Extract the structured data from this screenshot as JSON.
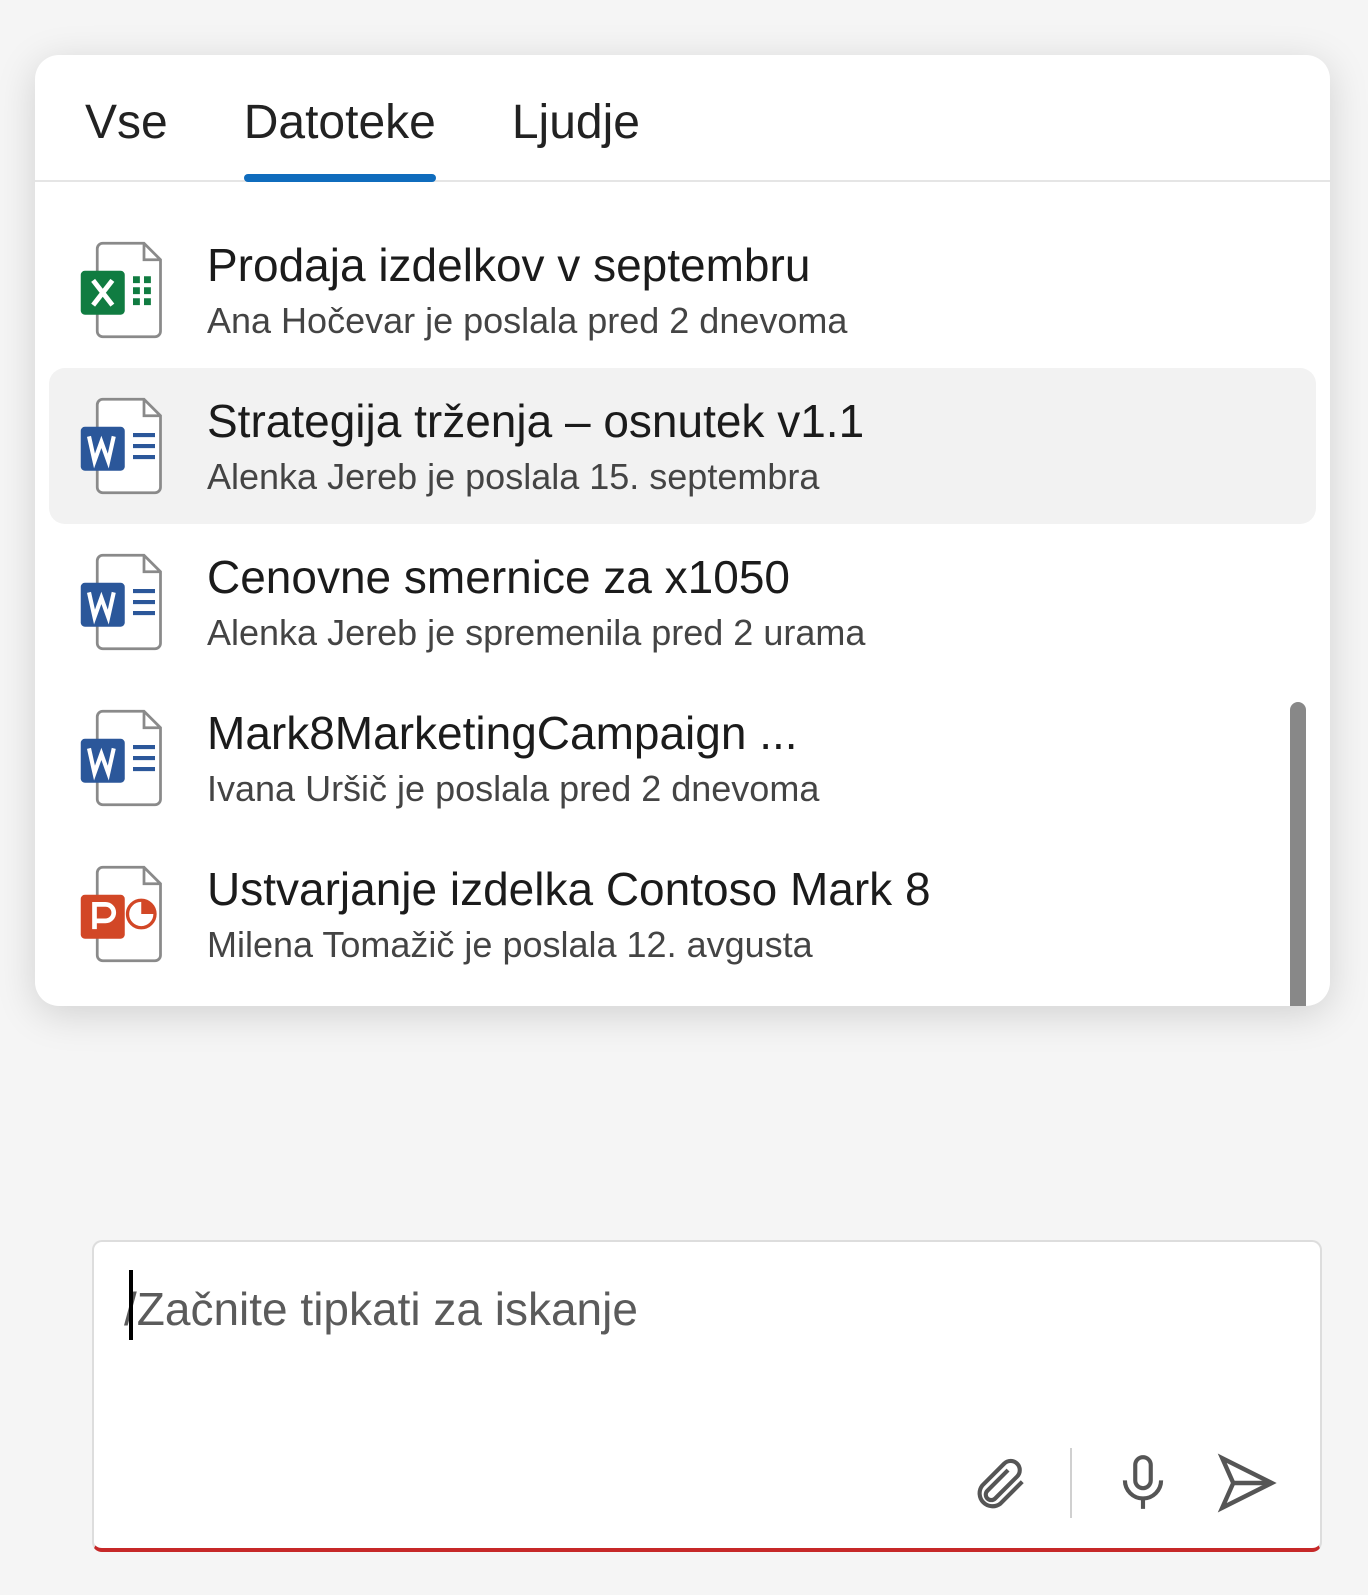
{
  "tabs": [
    {
      "label": "Vse"
    },
    {
      "label": "Datoteke",
      "active": true
    },
    {
      "label": "Ljudje"
    }
  ],
  "results": [
    {
      "icon": "excel",
      "title": "Prodaja izdelkov v septembru",
      "meta": "Ana Hočevar je poslala pred 2 dnevoma"
    },
    {
      "icon": "word",
      "title": "Strategija trženja – osnutek v1.1",
      "meta": "Alenka Jereb je poslala 15. septembra",
      "hover": true
    },
    {
      "icon": "word",
      "title": "Cenovne smernice za x1050",
      "meta": "Alenka Jereb je spremenila pred 2 urama"
    },
    {
      "icon": "word",
      "title": "Mark8MarketingCampaign ...",
      "meta": "Ivana Uršič je poslala pred 2 dnevoma"
    },
    {
      "icon": "powerpoint",
      "title": "Ustvarjanje izdelka Contoso Mark 8",
      "meta": "Milena Tomažič je poslala 12. avgusta"
    }
  ],
  "compose": {
    "prefix": "/",
    "placeholder": "Začnite tipkati za iskanje"
  },
  "icons": {
    "attach": "paperclip-icon",
    "mic": "microphone-icon",
    "send": "send-icon"
  }
}
